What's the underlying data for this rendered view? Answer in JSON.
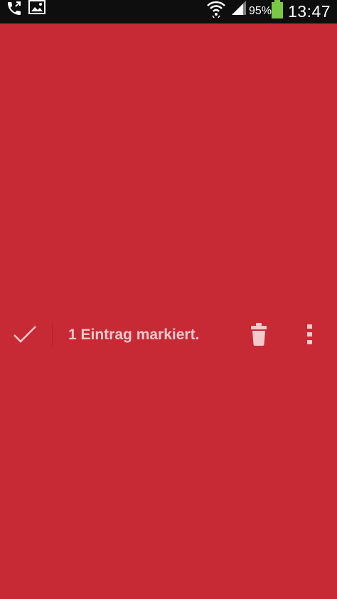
{
  "status_bar": {
    "icons": [
      "call-forward-icon",
      "image-icon",
      "wifi-icon",
      "signal-icon",
      "battery-icon"
    ],
    "battery_percent": "95%",
    "time": "13:47",
    "battery_color": "#7ac943"
  },
  "action_mode": {
    "title": "1 Eintrag markiert.",
    "done_icon": "checkmark-icon",
    "actions": [
      "trash-icon",
      "overflow-menu-icon"
    ],
    "background_color": "#c82a35",
    "text_color": "#f5c9cc"
  }
}
